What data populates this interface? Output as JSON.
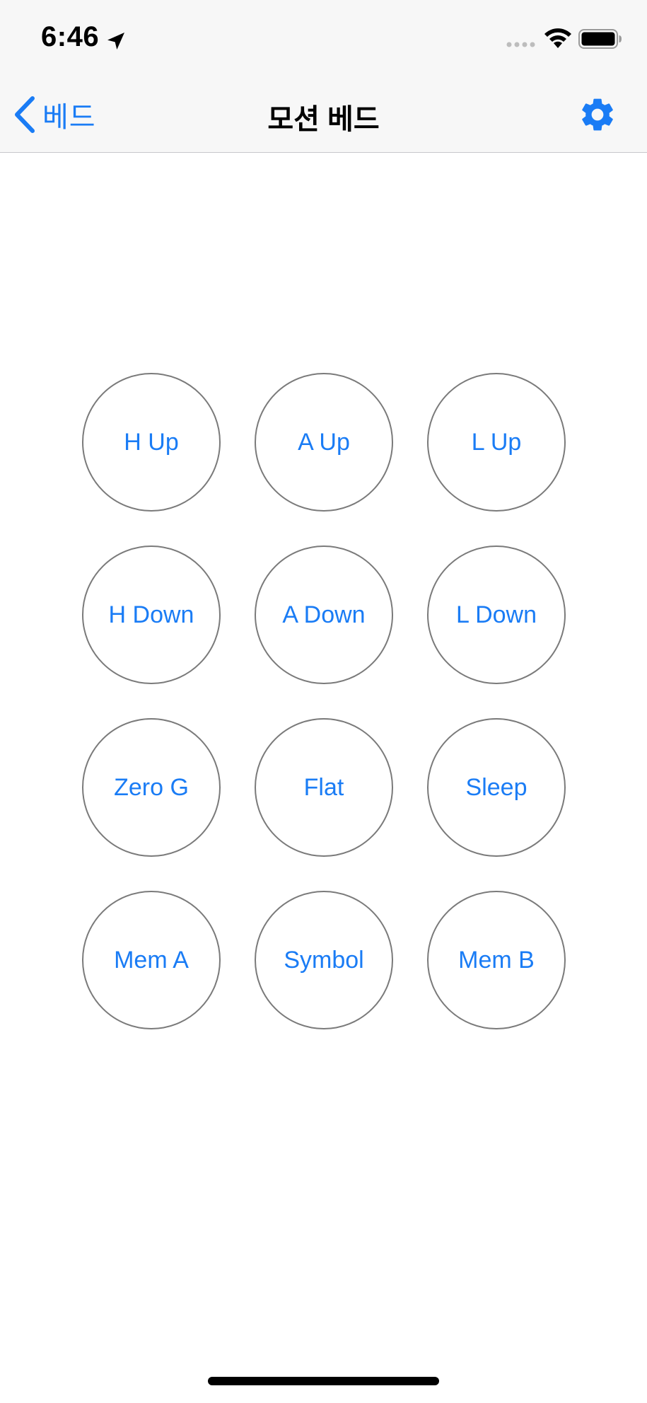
{
  "status_bar": {
    "time": "6:46",
    "icons": [
      "location-arrow-icon",
      "cellular-signal-icon",
      "wifi-icon",
      "battery-icon"
    ]
  },
  "nav": {
    "back_label": "베드",
    "title": "모션 베드",
    "settings_icon": "gear-icon"
  },
  "colors": {
    "accent": "#1a7cf5",
    "circle_border": "#7a7a7a",
    "bar_background": "#f7f7f7"
  },
  "buttons": [
    "H Up",
    "A Up",
    "L Up",
    "H Down",
    "A Down",
    "L Down",
    "Zero G",
    "Flat",
    "Sleep",
    "Mem A",
    "Symbol",
    "Mem B"
  ]
}
